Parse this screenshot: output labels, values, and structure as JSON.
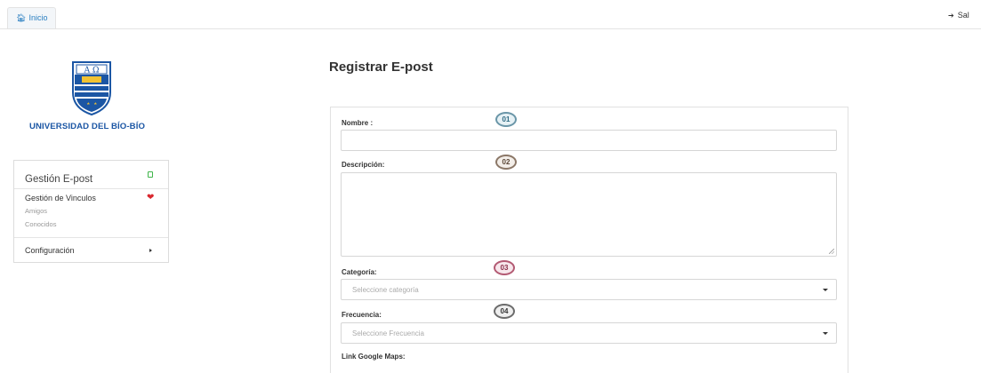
{
  "topbar": {
    "home_tab": "Inicio",
    "home_icon": "home-icon",
    "logout_label": "Sal",
    "logout_icon": "sign-out-icon"
  },
  "sidebar": {
    "university_name": "UNIVERSIDAD DEL BÍO-BÍO",
    "logo_letters": "A Ω",
    "menu": {
      "title": "Gestión E-post",
      "items": [
        {
          "label": "Gestión de Vinculos",
          "icon": "heart-icon",
          "subitems": [
            "Amigos",
            "Conocidos"
          ]
        },
        {
          "label": "Configuración",
          "icon": "caret-right-icon"
        }
      ]
    }
  },
  "form": {
    "title": "Registrar E-post",
    "fields": [
      {
        "label": "Nombre :",
        "badge": "01",
        "value": ""
      },
      {
        "label": "Descripción:",
        "badge": "02",
        "value": ""
      },
      {
        "label": "Categoría:",
        "badge": "03",
        "placeholder": "Seleccione categoría"
      },
      {
        "label": "Frecuencia:",
        "badge": "04",
        "placeholder": "Seleccione Frecuencia"
      },
      {
        "label": "Link Google Maps:"
      }
    ]
  },
  "colors": {
    "accent": "#2a7fc1",
    "university_blue": "#1b56a4",
    "heart": "#d9282f"
  }
}
